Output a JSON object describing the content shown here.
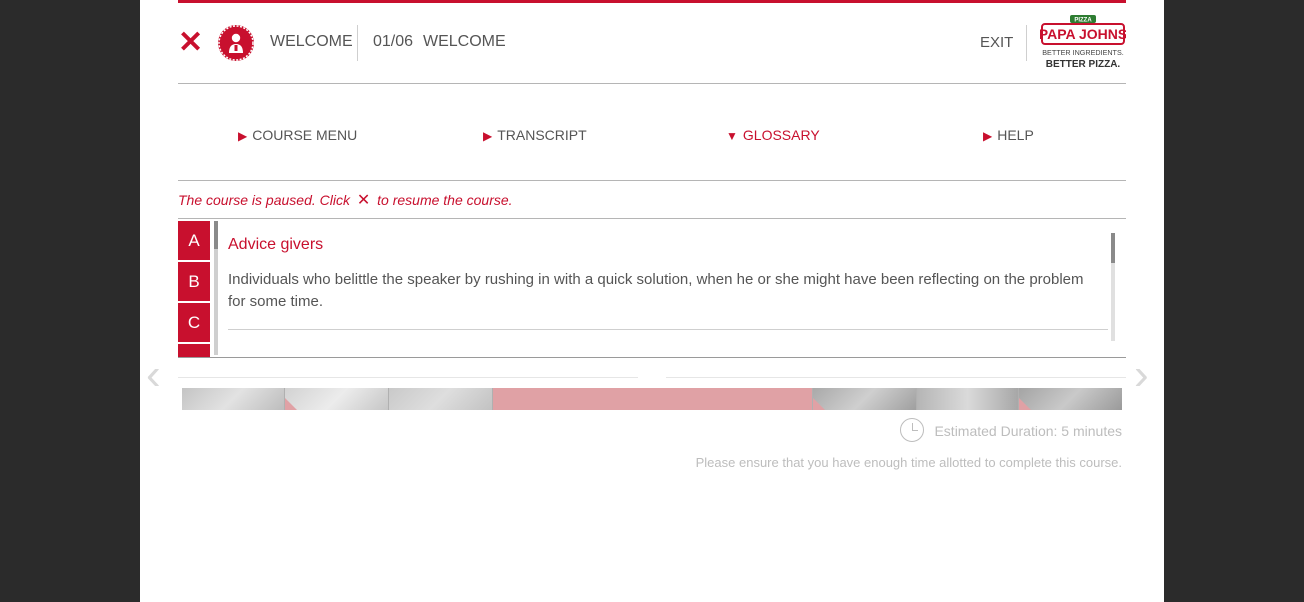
{
  "header": {
    "section_label": "WELCOME",
    "page_count": "01/06",
    "page_title": "WELCOME",
    "exit_label": "EXIT",
    "logo": {
      "brand": "PAPA JOHNS",
      "tagline_line1": "BETTER INGREDIENTS.",
      "tagline_line2": "BETTER PIZZA.",
      "badge": "PIZZA"
    }
  },
  "menu": {
    "items": [
      {
        "label": "COURSE MENU",
        "state": "collapsed"
      },
      {
        "label": "TRANSCRIPT",
        "state": "collapsed"
      },
      {
        "label": "GLOSSARY",
        "state": "expanded"
      },
      {
        "label": "HELP",
        "state": "collapsed"
      }
    ]
  },
  "paused_message": {
    "before": "The course is paused. Click",
    "after": "to resume the course."
  },
  "glossary": {
    "letters": [
      "A",
      "B",
      "C",
      ""
    ],
    "entry": {
      "term": "Advice givers",
      "definition": "Individuals who belittle the speaker by rushing in with a quick solution, when he or she might have been reflecting on the problem for some time."
    }
  },
  "filmstrip": {
    "frames": [
      {
        "active": false,
        "marked": false
      },
      {
        "active": false,
        "marked": true
      },
      {
        "active": false,
        "marked": false
      },
      {
        "active": true,
        "marked": false
      },
      {
        "active": false,
        "marked": true
      },
      {
        "active": false,
        "marked": false
      },
      {
        "active": false,
        "marked": true
      }
    ]
  },
  "duration": {
    "label": "Estimated Duration: 5 minutes",
    "note": "Please ensure that you have enough time allotted to complete this course."
  },
  "colors": {
    "accent": "#c8102e",
    "text": "#555555",
    "muted": "#bdbdbd",
    "outer_bg": "#2b2b2b",
    "active_frame": "#e0a1a5"
  },
  "icons": {
    "close": "close-icon",
    "avatar": "papa-john-avatar-icon",
    "clock": "clock-icon",
    "prev": "chevron-left-icon",
    "next": "chevron-right-icon"
  }
}
